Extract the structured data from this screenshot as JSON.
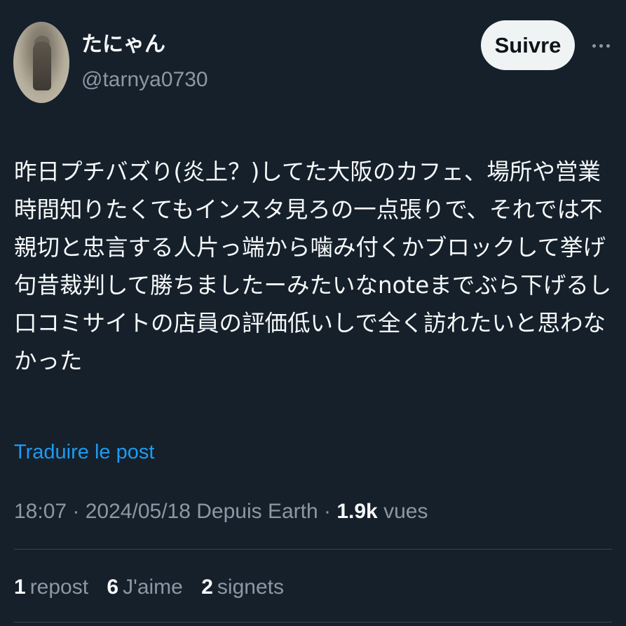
{
  "author": {
    "display_name": "たにゃん",
    "handle": "@tarnya0730"
  },
  "actions": {
    "follow_label": "Suivre",
    "more_icon": "more-horizontal-icon"
  },
  "tweet": {
    "text": "昨日プチバズり(炎上？)してた大阪のカフェ、場所や営業時間知りたくてもインスタ見ろの一点張りで、それでは不親切と忠言する人片っ端から噛み付くかブロックして挙げ句昔裁判して勝ちましたーみたいなnoteまでぶら下げるし口コミサイトの店員の評価低いしで全く訪れたいと思わなかった",
    "translate_label": "Traduire le post"
  },
  "meta": {
    "time": "18:07",
    "sep1": " · ",
    "date": "2024/05/18",
    "source": " Depuis Earth",
    "sep2": " · ",
    "views_count": "1.9k",
    "views_label": " vues"
  },
  "stats": {
    "reposts": {
      "count": "1",
      "label": "repost"
    },
    "likes": {
      "count": "6",
      "label": "J'aime"
    },
    "bookmarks": {
      "count": "2",
      "label": "signets"
    }
  },
  "colors": {
    "background": "#15202b",
    "text_primary": "#f7f9f9",
    "text_secondary": "#8b98a5",
    "link": "#1d9bf0",
    "follow_button_bg": "#eff3f4",
    "divider": "#38444d"
  }
}
